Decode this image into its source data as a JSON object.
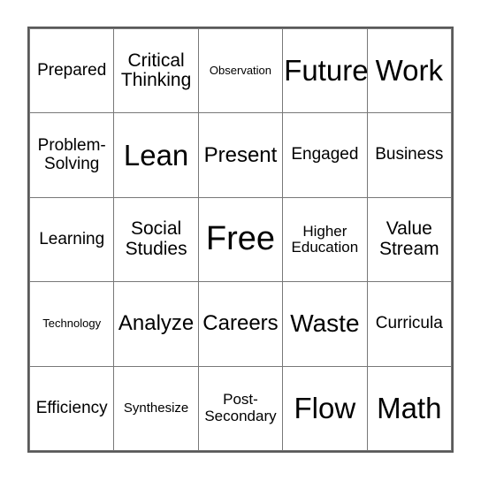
{
  "card": {
    "type": "bingo-card",
    "grid_size": 5,
    "border_color": "#5a5a5a",
    "gridline_color": "#787878",
    "background_color": "#ffffff",
    "text_color": "#000000",
    "rows": [
      [
        {
          "text": "Prepared",
          "size": "m"
        },
        {
          "text": "Critical\nThinking",
          "size": "l"
        },
        {
          "text": "Observation",
          "size": "xxs"
        },
        {
          "text": "Future",
          "size": "3xl"
        },
        {
          "text": "Work",
          "size": "3xl"
        }
      ],
      [
        {
          "text": "Problem-\nSolving",
          "size": "m"
        },
        {
          "text": "Lean",
          "size": "3xl"
        },
        {
          "text": "Present",
          "size": "xl"
        },
        {
          "text": "Engaged",
          "size": "m"
        },
        {
          "text": "Business",
          "size": "m"
        }
      ],
      [
        {
          "text": "Learning",
          "size": "m"
        },
        {
          "text": "Social\nStudies",
          "size": "l"
        },
        {
          "text": "Free",
          "size": "4xl"
        },
        {
          "text": "Higher\nEducation",
          "size": "s"
        },
        {
          "text": "Value\nStream",
          "size": "l"
        }
      ],
      [
        {
          "text": "Technology",
          "size": "xxs"
        },
        {
          "text": "Analyze",
          "size": "xl"
        },
        {
          "text": "Careers",
          "size": "xl"
        },
        {
          "text": "Waste",
          "size": "2xl"
        },
        {
          "text": "Curricula",
          "size": "m"
        }
      ],
      [
        {
          "text": "Efficiency",
          "size": "m"
        },
        {
          "text": "Synthesize",
          "size": "xs"
        },
        {
          "text": "Post-\nSecondary",
          "size": "s"
        },
        {
          "text": "Flow",
          "size": "3xl"
        },
        {
          "text": "Math",
          "size": "3xl"
        }
      ]
    ]
  }
}
